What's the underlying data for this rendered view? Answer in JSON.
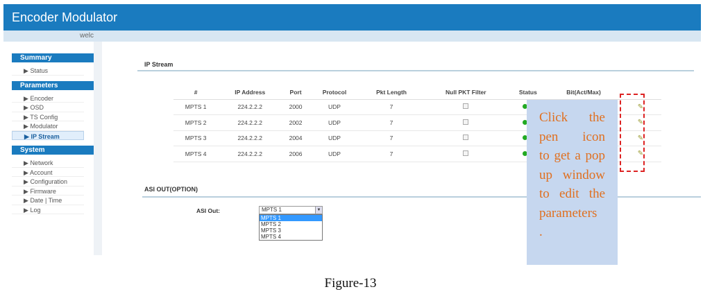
{
  "header": {
    "title": "Encoder Modulator",
    "welcome": "welc"
  },
  "sidebar": [
    {
      "section": "Summary",
      "items": [
        "Status"
      ]
    },
    {
      "section": "Parameters",
      "items": [
        "Encoder",
        "OSD",
        "TS Config",
        "Modulator",
        "IP Stream"
      ]
    },
    {
      "section": "System",
      "items": [
        "Network",
        "Account",
        "Configuration",
        "Firmware",
        "Date | Time",
        "Log"
      ]
    }
  ],
  "active_item": "IP Stream",
  "ip_stream": {
    "title": "IP Stream",
    "columns": [
      "#",
      "IP Address",
      "Port",
      "Protocol",
      "Pkt Length",
      "Null PKT Filter",
      "Status",
      "Bit(Act/Max)"
    ],
    "rows": [
      [
        "MPTS 1",
        "224.2.2.2",
        "2000",
        "UDP",
        "7"
      ],
      [
        "MPTS 2",
        "224.2.2.2",
        "2002",
        "UDP",
        "7"
      ],
      [
        "MPTS 3",
        "224.2.2.2",
        "2004",
        "UDP",
        "7"
      ],
      [
        "MPTS 4",
        "224.2.2.2",
        "2006",
        "UDP",
        "7"
      ]
    ]
  },
  "asi": {
    "title": "ASI OUT(OPTION)",
    "label": "ASI Out:",
    "selected": "MPTS 1",
    "options": [
      "MPTS 1",
      "MPTS 2",
      "MPTS 3",
      "MPTS 4"
    ]
  },
  "note": [
    "Click the",
    "pen icon",
    "to get a pop",
    "up window",
    "to edit the",
    "parameters",
    "."
  ],
  "caption": "Figure-13"
}
